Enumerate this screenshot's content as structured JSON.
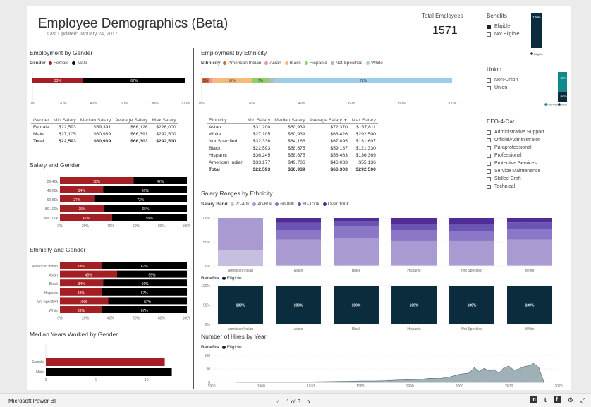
{
  "header": {
    "title": "Employee Demographics (Beta)",
    "updated": "Last Updated: January 24, 2017",
    "total_label": "Total Employees",
    "total_value": "1571"
  },
  "colors": {
    "female": "#a31f24",
    "male": "#000000",
    "navy": "#0b2c3d",
    "teal": "#0e8a8c",
    "american_indian": "#cc6a3a",
    "asian": "#f48f9a",
    "black": "#f5b97a",
    "hispanic": "#8fcf6f",
    "not_specified": "#b8b8b8",
    "white": "#9ccde8",
    "band_20_40": "#c6bfe0",
    "band_40_60": "#a99ad2",
    "band_60_80": "#8a78c6",
    "band_80_100": "#6b54b4",
    "band_over_100": "#4f2c96",
    "timeline": "#9fb1b7"
  },
  "employment_by_gender": {
    "title": "Employment by Gender",
    "legend_label": "Gender",
    "legend": [
      "Female",
      "Male"
    ],
    "female_label": "33%",
    "male_label": "67%",
    "female_pct": 33,
    "male_pct": 67,
    "ticks": [
      "0%",
      "20%",
      "40%",
      "60%",
      "80%",
      "100%"
    ]
  },
  "gender_table": {
    "headers": [
      "Gender",
      "Min Salary",
      "Median Salary",
      "Average Salary",
      "Max Salary"
    ],
    "rows": [
      [
        "Female",
        "$22,593",
        "$59,391",
        "$66,128",
        "$226,000"
      ],
      [
        "Male",
        "$27,105",
        "$60,939",
        "$66,391",
        "$292,500"
      ]
    ],
    "total": [
      "Total",
      "$22,593",
      "$60,939",
      "$66,303",
      "$292,500"
    ]
  },
  "salary_and_gender": {
    "title": "Salary and Gender",
    "categories": [
      "20-40k",
      "40-60k",
      "60-80k",
      "80-100k",
      "Over 100k"
    ],
    "female": [
      58,
      34,
      27,
      35,
      41
    ],
    "male": [
      42,
      66,
      73,
      65,
      59
    ],
    "female_labels": [
      "58%",
      "34%",
      "27%",
      "35%",
      "41%"
    ],
    "male_labels": [
      "42%",
      "66%",
      "73%",
      "65%",
      "59%"
    ],
    "ticks": [
      "0%",
      "20%",
      "40%",
      "60%",
      "80%",
      "100%"
    ]
  },
  "ethnicity_and_gender": {
    "title": "Ethnicity and Gender",
    "categories": [
      "American Indian",
      "Asian",
      "Black",
      "Hispanic",
      "Not Specified",
      "White"
    ],
    "female": [
      33,
      45,
      34,
      33,
      38,
      33
    ],
    "male": [
      67,
      55,
      66,
      67,
      62,
      67
    ],
    "female_labels": [
      "33%",
      "45%",
      "34%",
      "33%",
      "38%",
      "33%"
    ],
    "male_labels": [
      "67%",
      "55%",
      "66%",
      "67%",
      "62%",
      "67%"
    ],
    "ticks": [
      "0%",
      "20%",
      "40%",
      "60%",
      "80%",
      "100%"
    ]
  },
  "median_years": {
    "title": "Median Years Worked by Gender",
    "categories": [
      "Female",
      "Male"
    ],
    "values": [
      11.8,
      12.5
    ],
    "ticks": [
      "0",
      "5",
      "10"
    ],
    "xlim": [
      0,
      14
    ]
  },
  "employment_by_ethnicity": {
    "title": "Employment by Ethnicity",
    "legend_label": "Ethnicity",
    "legend": [
      "American Indian",
      "Asian",
      "Black",
      "Hispanic",
      "Not Specified",
      "White"
    ],
    "values": [
      3,
      1,
      16,
      7,
      2,
      71
    ],
    "labels": [
      "3%",
      "",
      "16%",
      "7%",
      "",
      "71%"
    ],
    "ticks": [
      "0%",
      "20%",
      "40%",
      "60%",
      "80%",
      "100%"
    ]
  },
  "ethnicity_table": {
    "headers": [
      "Ethnicity",
      "Min Salary",
      "Median Salary",
      "Average Salary",
      "Max Salary"
    ],
    "rows": [
      [
        "Asian",
        "$31,200",
        "$60,939",
        "$72,370",
        "$187,811"
      ],
      [
        "White",
        "$27,105",
        "$60,939",
        "$68,426",
        "$292,500"
      ],
      [
        "Not Specified",
        "$32,336",
        "$64,166",
        "$67,895",
        "$131,607"
      ],
      [
        "Black",
        "$22,593",
        "$58,675",
        "$59,187",
        "$121,330"
      ],
      [
        "Hispanic",
        "$36,245",
        "$58,675",
        "$58,463",
        "$136,369"
      ],
      [
        "American Indian",
        "$33,177",
        "$49,786",
        "$46,033",
        "$55,136"
      ]
    ],
    "total": [
      "Total",
      "$22,593",
      "$60,939",
      "$66,303",
      "$292,500"
    ]
  },
  "salary_ranges_by_ethnicity": {
    "title": "Salary Ranges by Ethnicity",
    "legend_label": "Salary Band",
    "legend": [
      "20-40k",
      "40-60k",
      "60-80k",
      "80-100k",
      "Over 100k"
    ],
    "categories": [
      "American Indian",
      "Asian",
      "Black",
      "Hispanic",
      "Not Specified",
      "White"
    ],
    "series": [
      {
        "name": "20-40k",
        "values": [
          33,
          3,
          3,
          3,
          3,
          3
        ]
      },
      {
        "name": "40-60k",
        "values": [
          67,
          52,
          55,
          50,
          50,
          52
        ]
      },
      {
        "name": "60-80k",
        "values": [
          0,
          20,
          25,
          22,
          20,
          22
        ]
      },
      {
        "name": "80-100k",
        "values": [
          0,
          15,
          10,
          13,
          15,
          14
        ]
      },
      {
        "name": "Over 100k",
        "values": [
          0,
          10,
          7,
          12,
          12,
          9
        ]
      }
    ],
    "ticks": [
      "0%",
      "50%",
      "100%"
    ]
  },
  "benefits_by_ethnicity": {
    "legend_label": "Benefits",
    "legend": [
      "Eligible"
    ],
    "categories": [
      "American Indian",
      "Asian",
      "Black",
      "Hispanic",
      "Not Specified",
      "White"
    ],
    "values": [
      100,
      100,
      100,
      100,
      100,
      100
    ],
    "labels": [
      "100%",
      "100%",
      "100%",
      "100%",
      "100%",
      "100%"
    ],
    "ticks": [
      "0%",
      "50%",
      "100%"
    ]
  },
  "hires_by_year": {
    "title": "Number of Hires by Year",
    "legend_label": "Benefits",
    "legend": [
      "Eligible"
    ],
    "x": [
      1955,
      1960,
      1965,
      1970,
      1975,
      1978,
      1980,
      1983,
      1985,
      1987,
      1990,
      1992,
      1994,
      1996,
      1998,
      2000,
      2002,
      2003,
      2004,
      2005,
      2006,
      2007,
      2008,
      2009,
      2010,
      2011,
      2012,
      2013,
      2014,
      2015,
      2016,
      2017
    ],
    "y": [
      1,
      1,
      2,
      2,
      3,
      4,
      5,
      5,
      6,
      8,
      10,
      11,
      15,
      14,
      20,
      30,
      35,
      55,
      40,
      52,
      42,
      48,
      35,
      55,
      60,
      45,
      50,
      58,
      62,
      70,
      55,
      3
    ],
    "xticks": [
      "1950",
      "1960",
      "1970",
      "1980",
      "1990",
      "2000",
      "2010",
      "2020"
    ],
    "yticks": [
      "0",
      "50",
      "100"
    ],
    "xlim": [
      1950,
      2020
    ],
    "ylim": [
      0,
      100
    ]
  },
  "benefits_slicer": {
    "title": "Benefits",
    "options": [
      "Eligible",
      "Not Eligible"
    ],
    "checked": [
      true,
      false
    ],
    "bar_label": "100%",
    "legend": "Eligible"
  },
  "union_slicer": {
    "title": "Union",
    "options": [
      "Non-Union",
      "Union"
    ],
    "checked": [
      false,
      false
    ],
    "non_union_pct": 66,
    "union_pct": 34,
    "non_union_label": "66%",
    "union_label": "34%",
    "legend": [
      "Non-Union",
      "Union"
    ]
  },
  "eeo_slicer": {
    "title": "EEO-4-Cat",
    "options": [
      "Administrative Support",
      "Official/Administrator",
      "Paraprofessional",
      "Professional",
      "Protective Services",
      "Service Maintenance",
      "Skilled Craft",
      "Technical"
    ]
  },
  "footer": {
    "brand": "Microsoft Power BI",
    "pager": "1 of 3",
    "prev": "‹",
    "next": "›",
    "icons": [
      "linkedin-icon",
      "twitter-icon",
      "facebook-icon",
      "settings-icon",
      "fullscreen-icon"
    ],
    "linkedin": "in",
    "twitter": "t",
    "facebook": "f",
    "settings": "⚙",
    "fullscreen": "⤢"
  }
}
